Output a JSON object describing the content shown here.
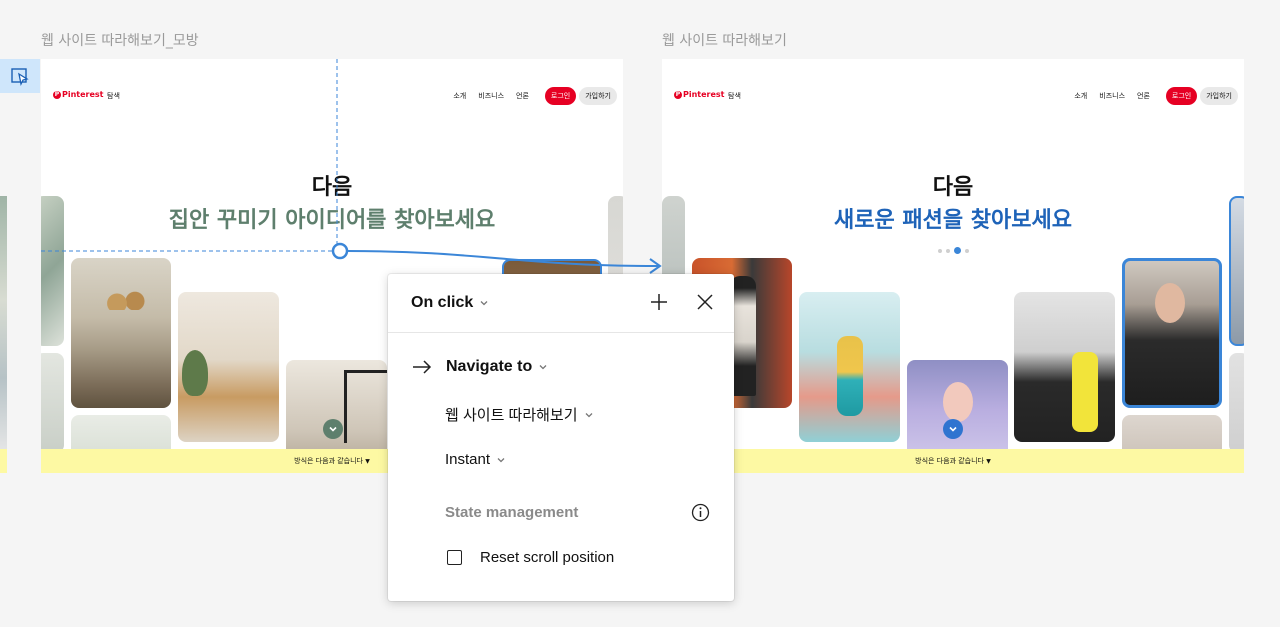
{
  "frames": {
    "left": {
      "label": "웹 사이트 따라해보기_모방",
      "hero_line1": "다음",
      "hero_line2": "집안 꾸미기 아이디어를 찾아보세요",
      "accent_color": "#5e7f6d"
    },
    "right": {
      "label": "웹 사이트 따라해보기",
      "hero_line1": "다음",
      "hero_line2": "새로운 패션을 찾아보세요",
      "accent_color": "#1e63b8"
    }
  },
  "site": {
    "logo": "Pinterest",
    "explore": "탐색",
    "nav_about": "소개",
    "nav_business": "비즈니스",
    "nav_press": "언론",
    "login": "로그인",
    "signup": "가입하기",
    "banner_text": "방식은 다음과 같습니다"
  },
  "scroll_icon": "chevron-down-icon",
  "selection_color": "#3b86d8",
  "interaction_panel": {
    "trigger": "On click",
    "add_icon": "plus-icon",
    "close_icon": "close-icon",
    "action": "Navigate to",
    "destination": "웹 사이트 따라해보기",
    "animation": "Instant",
    "state_management_label": "State management",
    "reset_scroll_label": "Reset scroll position",
    "reset_scroll_checked": false
  }
}
